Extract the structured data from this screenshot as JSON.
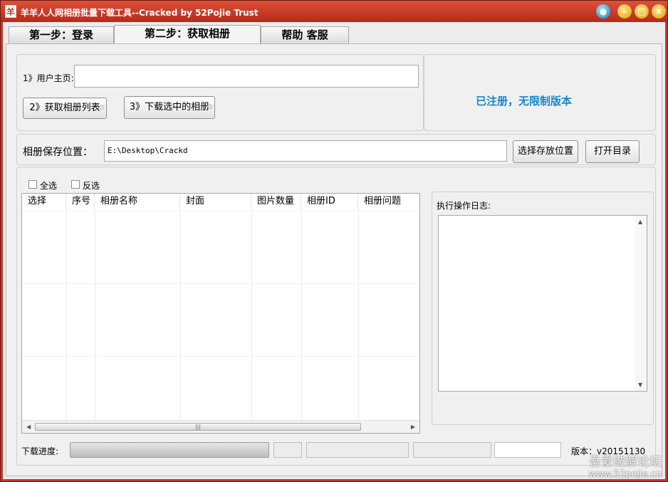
{
  "window": {
    "title": "羊羊人人网相册批量下载工具--Cracked by 52Pojie Trust",
    "icon_glyph": "羊"
  },
  "tabs": [
    {
      "label": "第一步：登录"
    },
    {
      "label": "第二步：获取相册"
    },
    {
      "label": "帮助 客服"
    }
  ],
  "homepage": {
    "label": "1》用户主页:",
    "value": ""
  },
  "buttons": {
    "get_albums": "2》获取相册列表",
    "download_selected": "3》下载选中的相册",
    "choose_location": "选择存放位置",
    "open_dir": "打开目录"
  },
  "registration_status": "已注册，无限制版本",
  "save_location": {
    "label": "相册保存位置：",
    "value": "E:\\Desktop\\Crackd"
  },
  "selection": {
    "select_all": "全选",
    "invert": "反选"
  },
  "table": {
    "columns": [
      "选择",
      "序号",
      "相册名称",
      "封面",
      "图片数量",
      "相册ID",
      "相册问题"
    ],
    "rows": []
  },
  "log": {
    "label": "执行操作日志:",
    "content": ""
  },
  "progress": {
    "label": "下载进度:",
    "value": 1.0
  },
  "version": "版本：v20151130",
  "watermark": {
    "line1": "吾爱破解论坛",
    "line2": "www.52pojie.cn"
  },
  "colors": {
    "title_bar": "#c0392b",
    "status_blue": "#1a86c8"
  }
}
